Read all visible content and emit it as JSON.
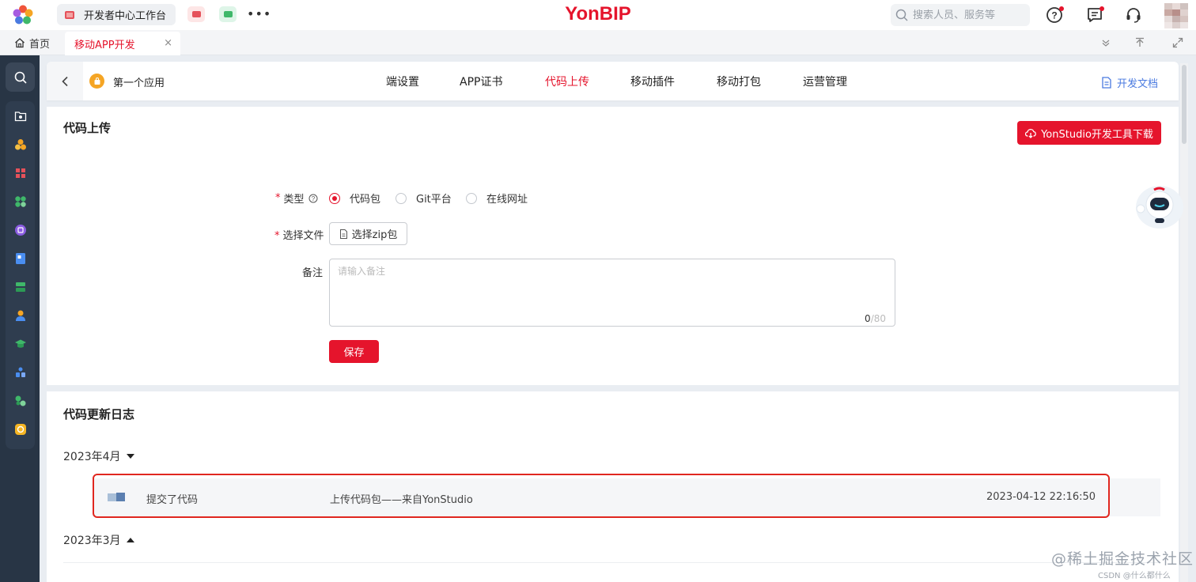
{
  "topbar": {
    "active_tab": "开发者中心工作台",
    "brand": "YonBIP",
    "search_placeholder": "搜索人员、服务等",
    "more": "•••"
  },
  "tabs": {
    "home": "首页",
    "app_tab": "移动APP开发",
    "close": "×"
  },
  "app": {
    "name": "第一个应用",
    "nav": [
      "端设置",
      "APP证书",
      "代码上传",
      "移动插件",
      "移动打包",
      "运营管理"
    ],
    "active_nav": "代码上传",
    "doc_link": "开发文档"
  },
  "upload": {
    "title": "代码上传",
    "download_button": "YonStudio开发工具下载",
    "type_label": "类型",
    "type_options": [
      "代码包",
      "Git平台",
      "在线网址"
    ],
    "type_selected": "代码包",
    "file_label": "选择文件",
    "file_button": "选择zip包",
    "remark_label": "备注",
    "remark_placeholder": "请输入备注",
    "remark_count": "0",
    "remark_max": "/80",
    "save_button": "保存"
  },
  "log": {
    "title": "代码更新日志",
    "groups": [
      {
        "month": "2023年4月",
        "expanded": true,
        "entries": [
          {
            "action": "提交了代码",
            "description": "上传代码包——来自YonStudio",
            "time": "2023-04-12 22:16:50"
          }
        ]
      },
      {
        "month": "2023年3月",
        "expanded": false,
        "entries": []
      }
    ]
  },
  "watermark": "@稀土掘金技术社区",
  "csdn": "CSDN @什么都什么",
  "colors": {
    "accent": "#e5142c",
    "rail": "#283545",
    "link": "#4a7ae0",
    "highlight_outline": "#e0271f"
  }
}
